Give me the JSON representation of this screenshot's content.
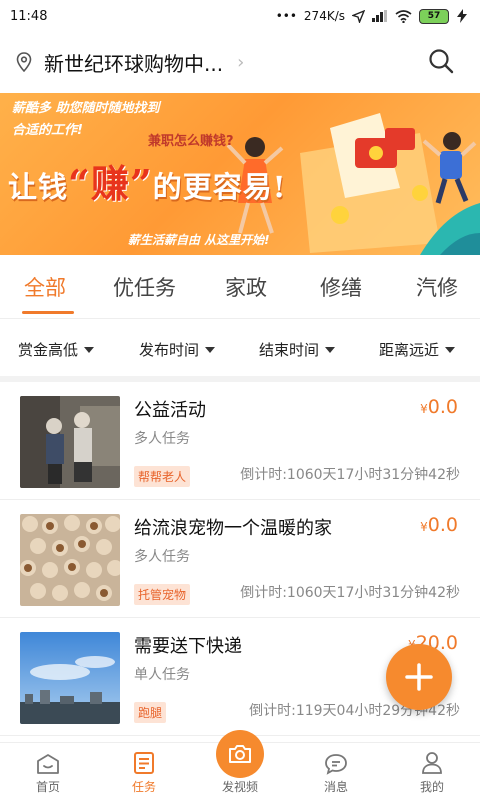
{
  "status_bar": {
    "time": "11:48",
    "network_speed": "274K/s",
    "battery": "57"
  },
  "header": {
    "location": "新世纪环球购物中..."
  },
  "banner": {
    "line1": "薪酷多 助您随时随地找到",
    "line2": "合适的工作!",
    "question": "兼职怎么赚钱?",
    "headline_pre": "让钱",
    "headline_big": "“赚”",
    "headline_post": "的更容易!",
    "bottom": "薪生活薪自由 从这里开始!"
  },
  "tabs": [
    "全部",
    "优任务",
    "家政",
    "修缮",
    "汽修"
  ],
  "active_tab": "全部",
  "filters": [
    "赏金高低",
    "发布时间",
    "结束时间",
    "距离远近"
  ],
  "tasks": [
    {
      "title": "公益活动",
      "type": "多人任务",
      "currency": "¥",
      "price": "0.0",
      "tag": "帮帮老人",
      "countdown": "倒计时:1060天17小时31分钟42秒"
    },
    {
      "title": "给流浪宠物一个温暖的家",
      "type": "多人任务",
      "currency": "¥",
      "price": "0.0",
      "tag": "托管宠物",
      "countdown": "倒计时:1060天17小时31分钟42秒"
    },
    {
      "title": "需要送下快递",
      "type": "单人任务",
      "currency": "¥",
      "price": "20.0",
      "tag": "跑腿",
      "countdown": "倒计时:119天04小时29分钟42秒"
    }
  ],
  "bottom_nav": [
    {
      "label": "首页",
      "icon": "home-icon"
    },
    {
      "label": "任务",
      "icon": "task-list-icon"
    },
    {
      "label": "发视频",
      "icon": "camera-icon"
    },
    {
      "label": "消息",
      "icon": "message-icon"
    },
    {
      "label": "我的",
      "icon": "profile-icon"
    }
  ],
  "colors": {
    "accent": "#f07a2b",
    "tag_bg": "#fde3d5"
  }
}
